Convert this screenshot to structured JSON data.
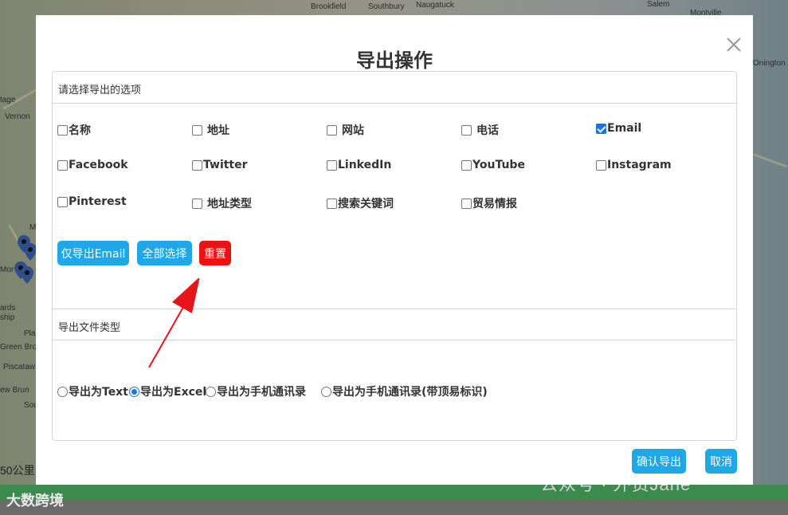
{
  "map": {
    "labels": [
      "Brookfield",
      "Southbury",
      "Naugatuck",
      "Salem",
      "Montville",
      "tage",
      "Vernon",
      "Onington",
      "ards",
      "ship",
      "Green Bro",
      "Piscataw",
      "ew Brun",
      "Sou",
      "Pla",
      "Mor",
      "M"
    ],
    "scale": "50公里"
  },
  "modal": {
    "title": "导出操作",
    "close_icon": "close-icon",
    "options_section_title": "请选择导出的选项",
    "fields": [
      {
        "label": "名称",
        "checked": false,
        "spaced": false
      },
      {
        "label": "地址",
        "checked": false,
        "spaced": true
      },
      {
        "label": "网站",
        "checked": false,
        "spaced": true
      },
      {
        "label": "电话",
        "checked": false,
        "spaced": true
      },
      {
        "label": "Email",
        "checked": true,
        "spaced": false
      },
      {
        "label": "Facebook",
        "checked": false,
        "spaced": false
      },
      {
        "label": "Twitter",
        "checked": false,
        "spaced": false
      },
      {
        "label": "LinkedIn",
        "checked": false,
        "spaced": false
      },
      {
        "label": "YouTube",
        "checked": false,
        "spaced": false
      },
      {
        "label": "Instagram",
        "checked": false,
        "spaced": false
      },
      {
        "label": "Pinterest",
        "checked": false,
        "spaced": false
      },
      {
        "label": "地址类型",
        "checked": false,
        "spaced": true
      },
      {
        "label": "搜索关键词",
        "checked": false,
        "spaced": false
      },
      {
        "label": "贸易情报",
        "checked": false,
        "spaced": false
      }
    ],
    "buttons": {
      "export_email_only": "仅导出Email",
      "select_all": "全部选择",
      "reset": "重置"
    },
    "file_type_section_title": "导出文件类型",
    "file_types": [
      {
        "label": "导出为Text",
        "selected": false
      },
      {
        "label": "导出为Excel",
        "selected": true
      },
      {
        "label": "导出为手机通讯录",
        "selected": false
      },
      {
        "label": "导出为手机通讯录(带顶易标识)",
        "selected": false
      }
    ],
    "confirm_label": "确认导出",
    "cancel_label": "取消"
  },
  "footer": {
    "brand": "大数跨境",
    "watermark": "公众号 · 外贸Jane"
  },
  "colors": {
    "primary_button": "#1fa7e8",
    "danger_button": "#ee1111",
    "annotation_arrow": "#e8141c"
  }
}
